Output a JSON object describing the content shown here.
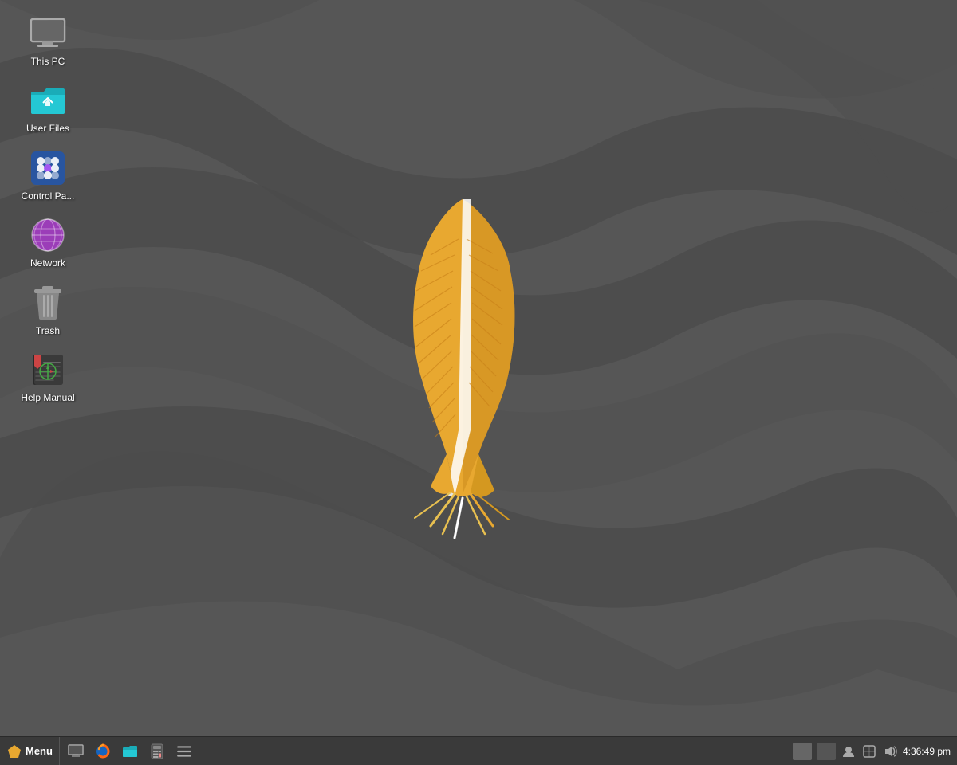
{
  "desktop": {
    "background_color": "#525252",
    "icons": [
      {
        "id": "this-pc",
        "label": "This PC",
        "icon_type": "monitor"
      },
      {
        "id": "user-files",
        "label": "User Files",
        "icon_type": "folder-home"
      },
      {
        "id": "control-panel",
        "label": "Control Pa...",
        "icon_type": "control-panel"
      },
      {
        "id": "network",
        "label": "Network",
        "icon_type": "network"
      },
      {
        "id": "trash",
        "label": "Trash",
        "icon_type": "trash"
      },
      {
        "id": "help-manual",
        "label": "Help Manual",
        "icon_type": "help"
      }
    ]
  },
  "taskbar": {
    "start_label": "Menu",
    "apps": [
      {
        "id": "taskbar-monitor",
        "icon": "monitor"
      },
      {
        "id": "taskbar-firefox",
        "icon": "firefox"
      },
      {
        "id": "taskbar-files",
        "icon": "files"
      },
      {
        "id": "taskbar-calculator",
        "icon": "calculator"
      },
      {
        "id": "taskbar-more",
        "icon": "more"
      }
    ],
    "tray": {
      "clock": "4:36:49 pm",
      "volume_icon": "volume",
      "network_icon": "network",
      "battery_icon": "battery"
    }
  }
}
